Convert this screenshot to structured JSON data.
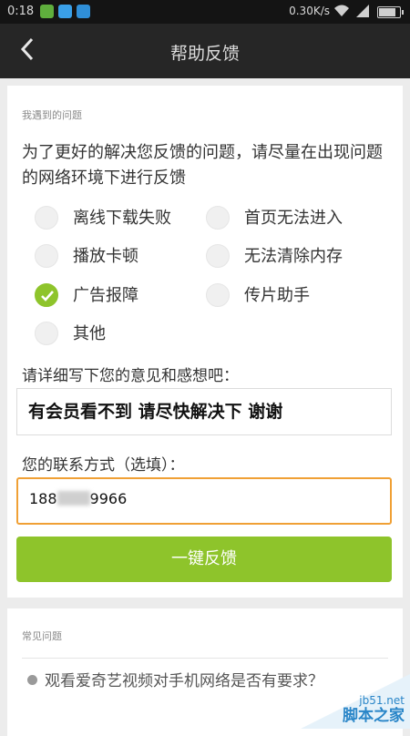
{
  "status_bar": {
    "time": "0:18",
    "network_speed": "0.30K/s"
  },
  "nav": {
    "title": "帮助反馈"
  },
  "problems": {
    "section_label": "我遇到的问题",
    "intro": "为了更好的解决您反馈的问题，请尽量在出现问题的网络环境下进行反馈",
    "options": [
      {
        "label": "离线下载失败",
        "checked": false
      },
      {
        "label": "首页无法进入",
        "checked": false
      },
      {
        "label": "播放卡顿",
        "checked": false
      },
      {
        "label": "无法清除内存",
        "checked": false
      },
      {
        "label": "广告报障",
        "checked": true
      },
      {
        "label": "传片助手",
        "checked": false
      },
      {
        "label": "其他",
        "checked": false
      }
    ]
  },
  "feedback": {
    "prompt": "请详细写下您的意见和感想吧：",
    "value": "有会员看不到 请尽快解决下 谢谢"
  },
  "contact": {
    "prompt": "您的联系方式（选填）：",
    "value_start": "188",
    "value_end": "9966"
  },
  "submit_label": "一键反馈",
  "faq": {
    "section_label": "常见问题",
    "items": [
      "观看爱奇艺视频对手机网络是否有要求？"
    ]
  },
  "watermark": {
    "url": "jb51.net",
    "brand": "脚本之家"
  },
  "colors": {
    "accent": "#8ec42b",
    "focus_border": "#f0a035",
    "nav_bg": "#262626"
  }
}
